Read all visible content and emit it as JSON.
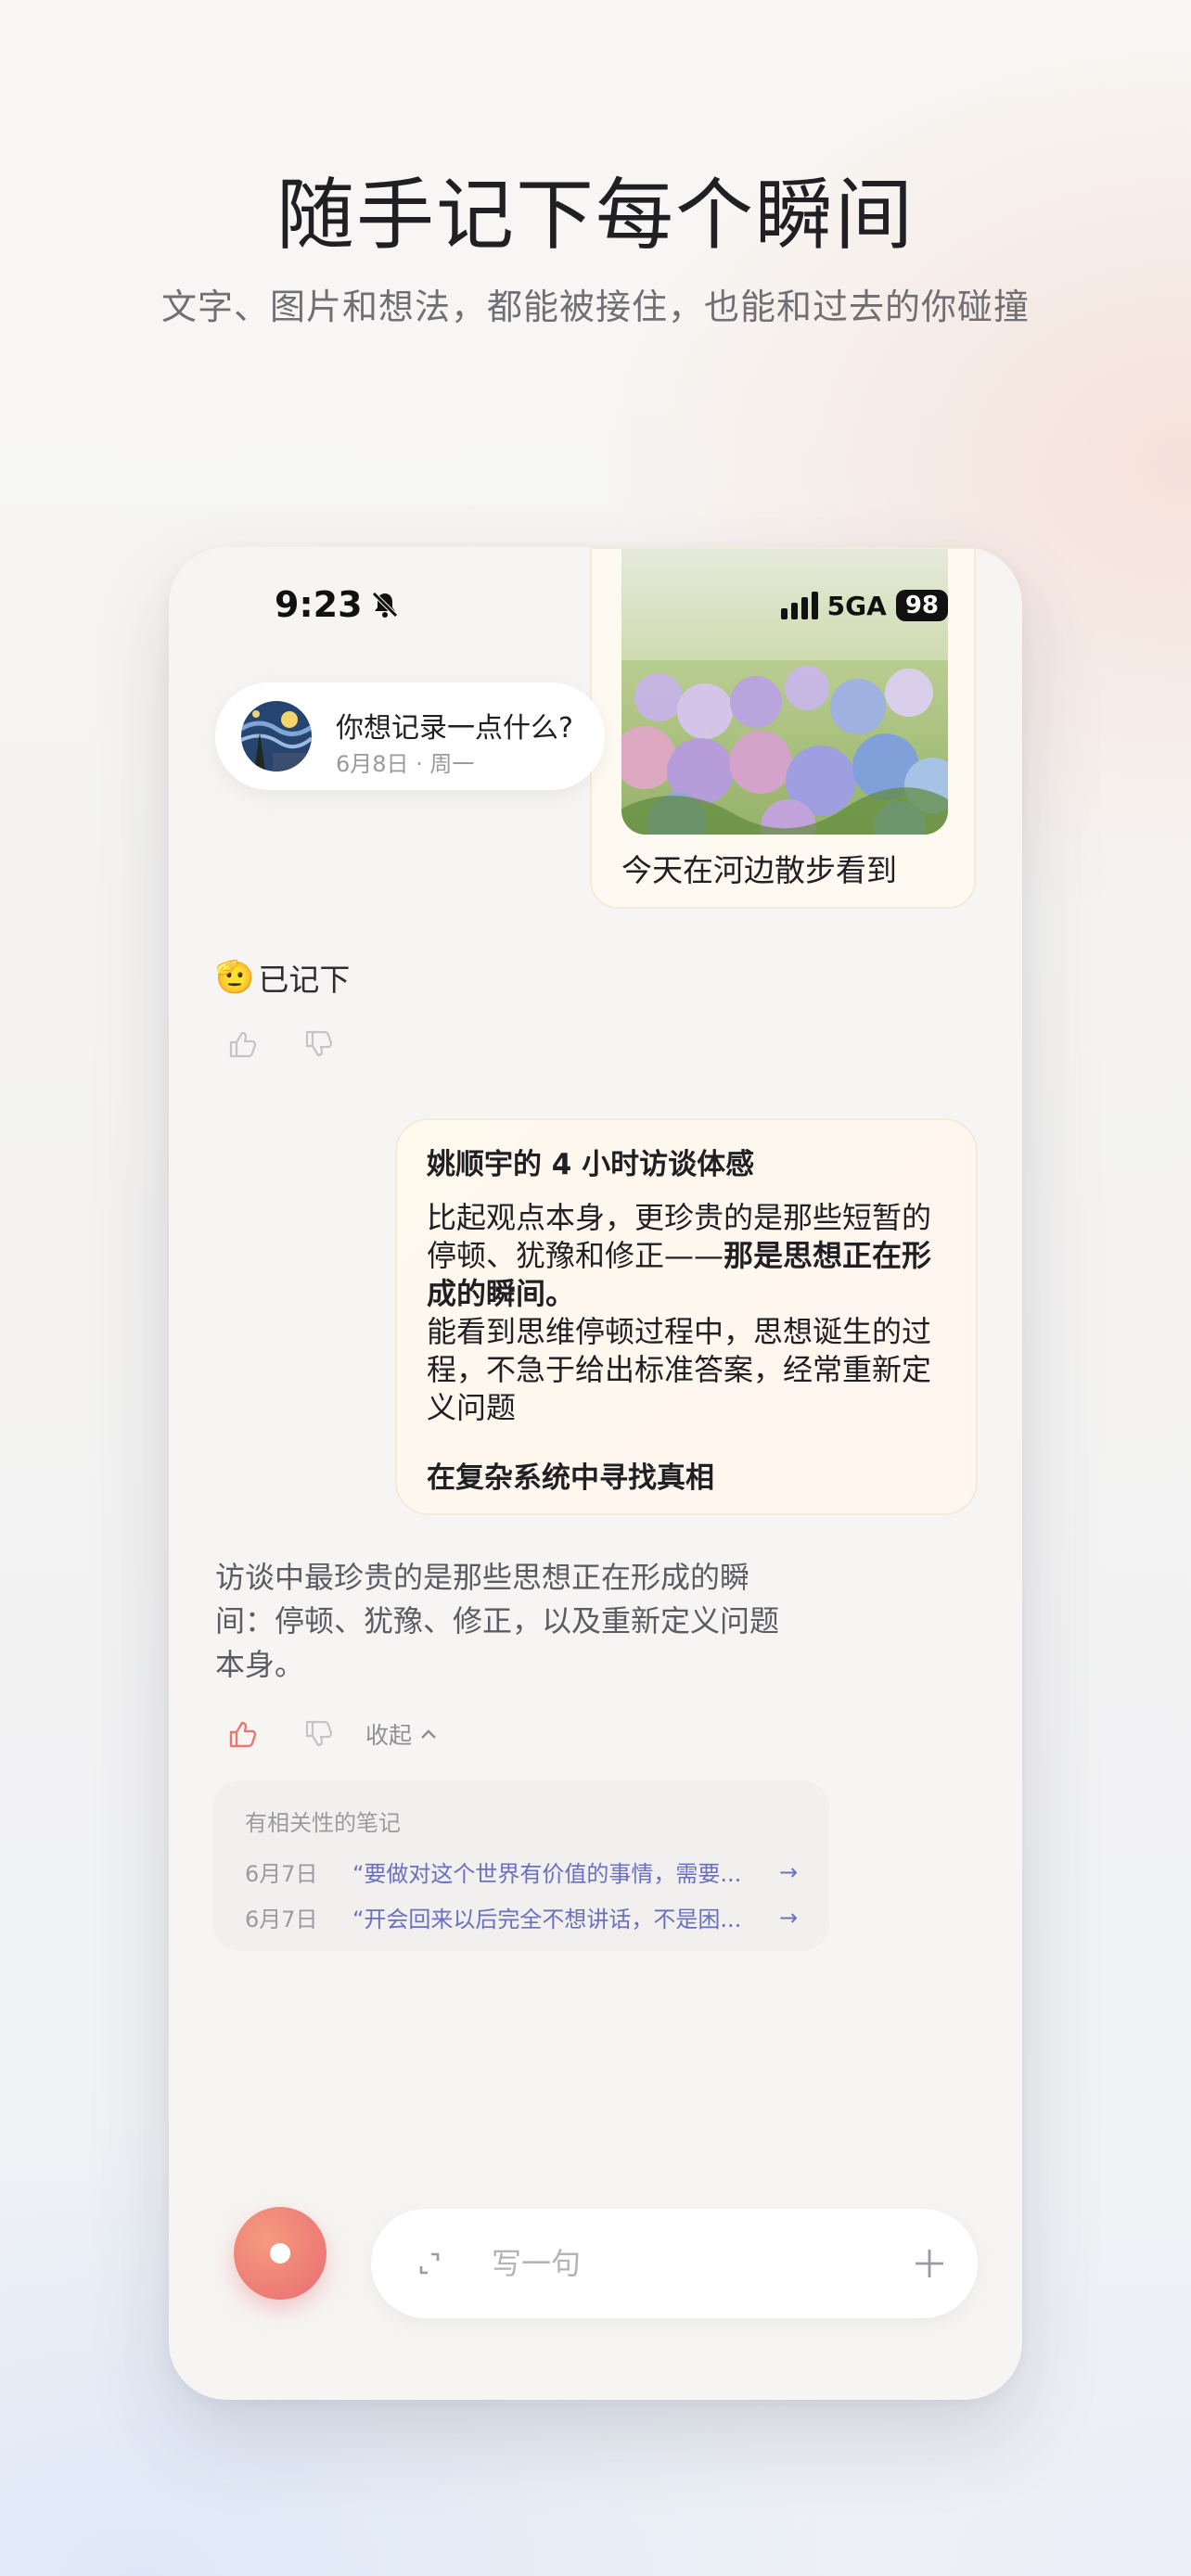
{
  "hero": {
    "title": "随手记下每个瞬间",
    "subtitle": "文字、图片和想法，都能被接住，也能和过去的你碰撞"
  },
  "status_bar": {
    "time": "9:23",
    "network": "5GA",
    "battery": "98"
  },
  "photo_note": {
    "caption": "今天在河边散步看到"
  },
  "prompt": {
    "title": "你想记录一点什么?",
    "date": "6月8日 · 周一"
  },
  "saved": {
    "label": "已记下"
  },
  "note": {
    "title": "姚顺宇的 4 小时访谈体感",
    "body_plain_1": "比起观点本身，更珍贵的是那些短暂的停顿、犹豫和修正——",
    "body_bold": "那是思想正在形成的瞬间。",
    "body_plain_2": "能看到思维停顿过程中，思想诞生的过程，不急于给出标准答案，经常重新定义问题",
    "footer": "在复杂系统中寻找真相"
  },
  "ai_reply": {
    "text": "访谈中最珍贵的是那些思想正在形成的瞬间：停顿、犹豫、修正，以及重新定义问题本身。",
    "collapse_label": "收起"
  },
  "related": {
    "title": "有相关性的笔记",
    "items": [
      {
        "date": "6月7日",
        "text": "“要做对这个世界有价值的事情，需要..."
      },
      {
        "date": "6月7日",
        "text": "“开会回来以后完全不想讲话，不是困..."
      }
    ]
  },
  "composer": {
    "placeholder": "写一句"
  },
  "colors": {
    "accent_record": "#e96d72",
    "link": "#6b6fbf",
    "thumb_active": "#e9776f"
  }
}
